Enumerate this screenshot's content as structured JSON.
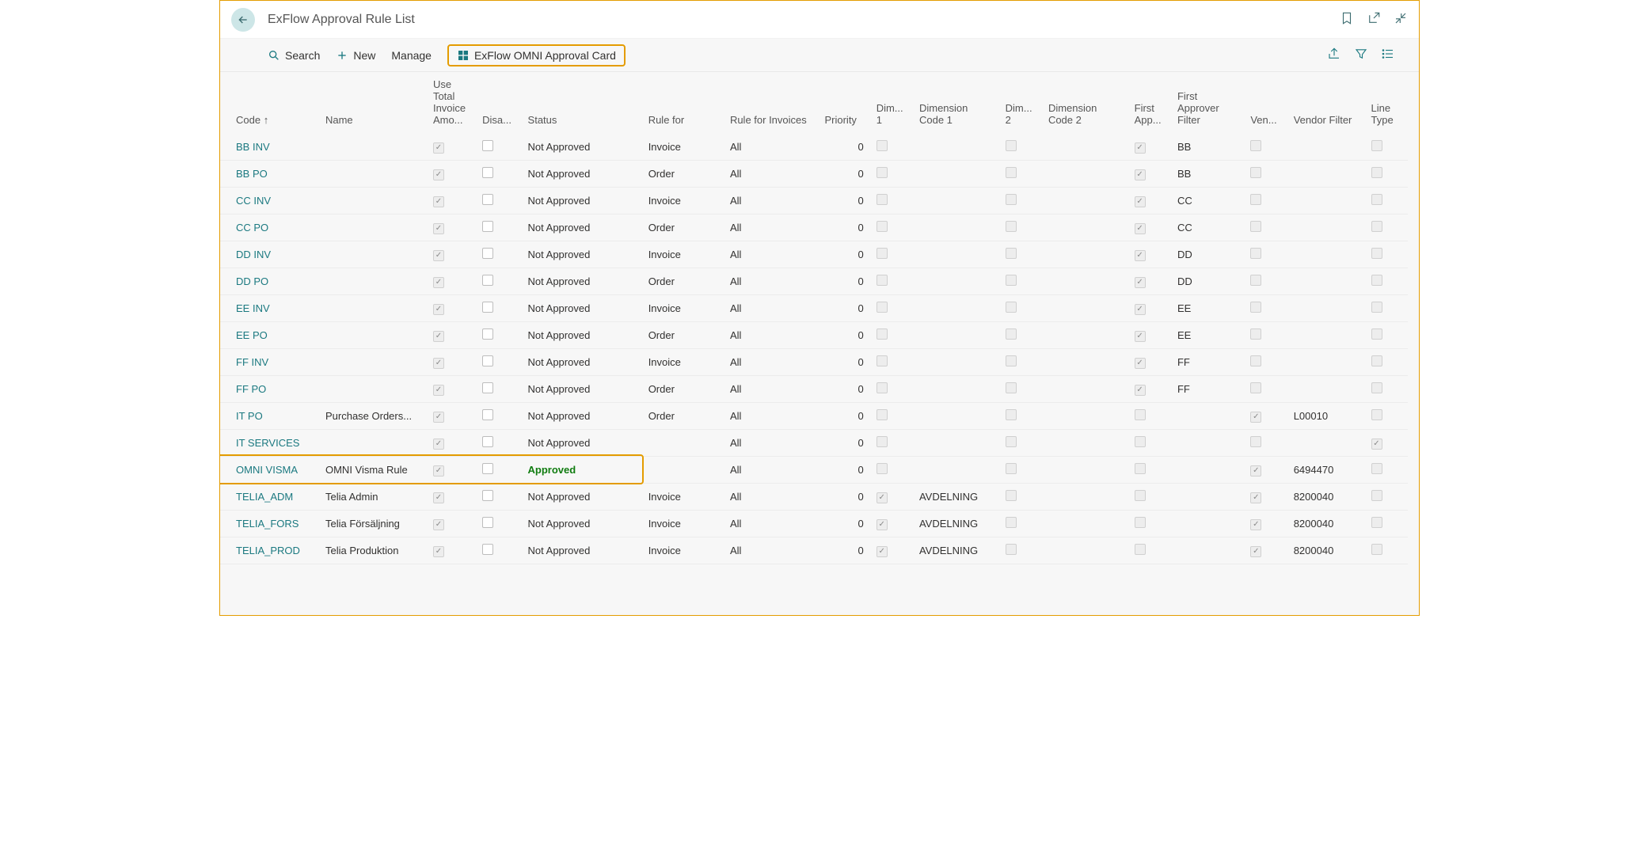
{
  "header": {
    "title": "ExFlow Approval Rule List"
  },
  "actions": {
    "search": "Search",
    "new": "New",
    "manage": "Manage",
    "omni_card": "ExFlow OMNI Approval Card"
  },
  "columns": {
    "code": "Code ↑",
    "name": "Name",
    "use_total": "Use Total Invoice Amo...",
    "disabled": "Disa...",
    "status": "Status",
    "rule_for": "Rule for",
    "rule_for_invoices": "Rule for Invoices",
    "priority": "Priority",
    "dim1": "Dim... 1",
    "dim_code1": "Dimension Code 1",
    "dim2": "Dim... 2",
    "dim_code2": "Dimension Code 2",
    "first_app": "First App...",
    "first_app_filter": "First Approver Filter",
    "ven": "Ven...",
    "vendor_filter": "Vendor Filter",
    "line_type": "Line Type"
  },
  "rows": [
    {
      "code": "BB INV",
      "name": "",
      "use": true,
      "dis": false,
      "status": "Not Approved",
      "rule_for": "Invoice",
      "rule_inv": "All",
      "priority": 0,
      "dim1": false,
      "dimc1": "",
      "dim2": false,
      "dimc2": "",
      "firstapp": true,
      "firstappf": "BB",
      "ven": false,
      "venf": "",
      "linetype": false
    },
    {
      "code": "BB PO",
      "name": "",
      "use": true,
      "dis": false,
      "status": "Not Approved",
      "rule_for": "Order",
      "rule_inv": "All",
      "priority": 0,
      "dim1": false,
      "dimc1": "",
      "dim2": false,
      "dimc2": "",
      "firstapp": true,
      "firstappf": "BB",
      "ven": false,
      "venf": "",
      "linetype": false
    },
    {
      "code": "CC INV",
      "name": "",
      "use": true,
      "dis": false,
      "status": "Not Approved",
      "rule_for": "Invoice",
      "rule_inv": "All",
      "priority": 0,
      "dim1": false,
      "dimc1": "",
      "dim2": false,
      "dimc2": "",
      "firstapp": true,
      "firstappf": "CC",
      "ven": false,
      "venf": "",
      "linetype": false
    },
    {
      "code": "CC PO",
      "name": "",
      "use": true,
      "dis": false,
      "status": "Not Approved",
      "rule_for": "Order",
      "rule_inv": "All",
      "priority": 0,
      "dim1": false,
      "dimc1": "",
      "dim2": false,
      "dimc2": "",
      "firstapp": true,
      "firstappf": "CC",
      "ven": false,
      "venf": "",
      "linetype": false
    },
    {
      "code": "DD INV",
      "name": "",
      "use": true,
      "dis": false,
      "status": "Not Approved",
      "rule_for": "Invoice",
      "rule_inv": "All",
      "priority": 0,
      "dim1": false,
      "dimc1": "",
      "dim2": false,
      "dimc2": "",
      "firstapp": true,
      "firstappf": "DD",
      "ven": false,
      "venf": "",
      "linetype": false
    },
    {
      "code": "DD PO",
      "name": "",
      "use": true,
      "dis": false,
      "status": "Not Approved",
      "rule_for": "Order",
      "rule_inv": "All",
      "priority": 0,
      "dim1": false,
      "dimc1": "",
      "dim2": false,
      "dimc2": "",
      "firstapp": true,
      "firstappf": "DD",
      "ven": false,
      "venf": "",
      "linetype": false
    },
    {
      "code": "EE INV",
      "name": "",
      "use": true,
      "dis": false,
      "status": "Not Approved",
      "rule_for": "Invoice",
      "rule_inv": "All",
      "priority": 0,
      "dim1": false,
      "dimc1": "",
      "dim2": false,
      "dimc2": "",
      "firstapp": true,
      "firstappf": "EE",
      "ven": false,
      "venf": "",
      "linetype": false
    },
    {
      "code": "EE PO",
      "name": "",
      "use": true,
      "dis": false,
      "status": "Not Approved",
      "rule_for": "Order",
      "rule_inv": "All",
      "priority": 0,
      "dim1": false,
      "dimc1": "",
      "dim2": false,
      "dimc2": "",
      "firstapp": true,
      "firstappf": "EE",
      "ven": false,
      "venf": "",
      "linetype": false
    },
    {
      "code": "FF INV",
      "name": "",
      "use": true,
      "dis": false,
      "status": "Not Approved",
      "rule_for": "Invoice",
      "rule_inv": "All",
      "priority": 0,
      "dim1": false,
      "dimc1": "",
      "dim2": false,
      "dimc2": "",
      "firstapp": true,
      "firstappf": "FF",
      "ven": false,
      "venf": "",
      "linetype": false
    },
    {
      "code": "FF PO",
      "name": "",
      "use": true,
      "dis": false,
      "status": "Not Approved",
      "rule_for": "Order",
      "rule_inv": "All",
      "priority": 0,
      "dim1": false,
      "dimc1": "",
      "dim2": false,
      "dimc2": "",
      "firstapp": true,
      "firstappf": "FF",
      "ven": false,
      "venf": "",
      "linetype": false
    },
    {
      "code": "IT PO",
      "name": "Purchase Orders...",
      "use": true,
      "dis": false,
      "status": "Not Approved",
      "rule_for": "Order",
      "rule_inv": "All",
      "priority": 0,
      "dim1": false,
      "dimc1": "",
      "dim2": false,
      "dimc2": "",
      "firstapp": false,
      "firstappf": "",
      "ven": true,
      "venf": "L00010",
      "linetype": false
    },
    {
      "code": "IT SERVICES",
      "name": "",
      "use": true,
      "dis": false,
      "status": "Not Approved",
      "rule_for": "",
      "rule_inv": "All",
      "priority": 0,
      "dim1": false,
      "dimc1": "",
      "dim2": false,
      "dimc2": "",
      "firstapp": false,
      "firstappf": "",
      "ven": false,
      "venf": "",
      "linetype": true
    },
    {
      "code": "OMNI VISMA",
      "name": "OMNI Visma Rule",
      "use": true,
      "dis": false,
      "status": "Approved",
      "rule_for": "",
      "rule_inv": "All",
      "priority": 0,
      "dim1": false,
      "dimc1": "",
      "dim2": false,
      "dimc2": "",
      "firstapp": false,
      "firstappf": "",
      "ven": true,
      "venf": "6494470",
      "linetype": false,
      "highlight": true
    },
    {
      "code": "TELIA_ADM",
      "name": "Telia Admin",
      "use": true,
      "dis": false,
      "status": "Not Approved",
      "rule_for": "Invoice",
      "rule_inv": "All",
      "priority": 0,
      "dim1": true,
      "dimc1": "AVDELNING",
      "dim2": false,
      "dimc2": "",
      "firstapp": false,
      "firstappf": "",
      "ven": true,
      "venf": "8200040",
      "linetype": false
    },
    {
      "code": "TELIA_FORS",
      "name": "Telia Försäljning",
      "use": true,
      "dis": false,
      "status": "Not Approved",
      "rule_for": "Invoice",
      "rule_inv": "All",
      "priority": 0,
      "dim1": true,
      "dimc1": "AVDELNING",
      "dim2": false,
      "dimc2": "",
      "firstapp": false,
      "firstappf": "",
      "ven": true,
      "venf": "8200040",
      "linetype": false
    },
    {
      "code": "TELIA_PROD",
      "name": "Telia Produktion",
      "use": true,
      "dis": false,
      "status": "Not Approved",
      "rule_for": "Invoice",
      "rule_inv": "All",
      "priority": 0,
      "dim1": true,
      "dimc1": "AVDELNING",
      "dim2": false,
      "dimc2": "",
      "firstapp": false,
      "firstappf": "",
      "ven": true,
      "venf": "8200040",
      "linetype": false
    }
  ]
}
